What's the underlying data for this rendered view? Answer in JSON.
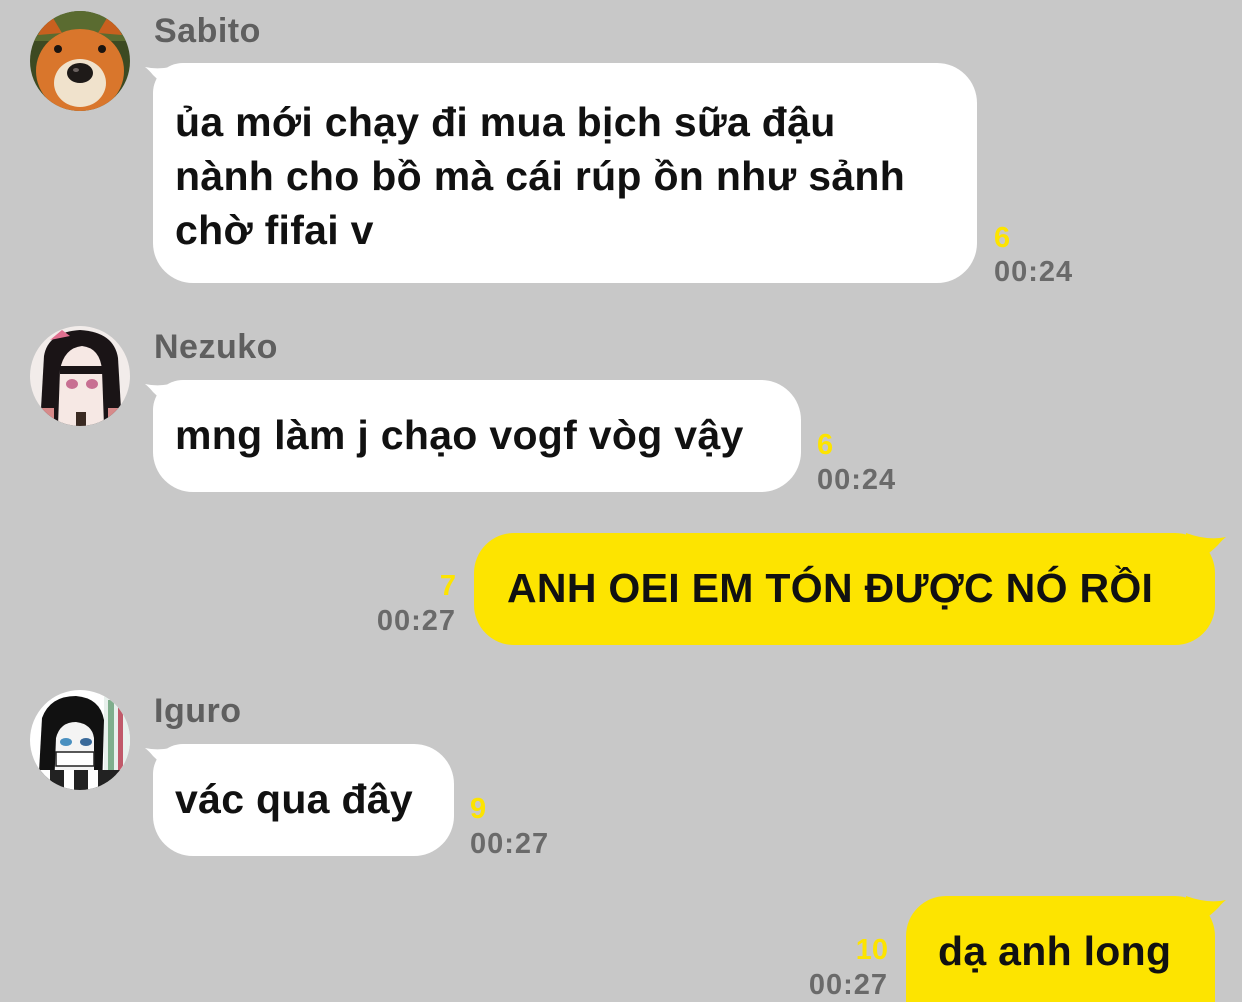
{
  "messages": [
    {
      "sender": "Sabito",
      "text_lines": [
        "ủa mới chạy đi mua bịch sữa đậu",
        "nành cho bồ mà cái rúp ồn như sảnh",
        "chờ fifai v"
      ],
      "unread": "6",
      "time": "00:24",
      "direction": "incoming",
      "avatar": "fox-avatar-icon"
    },
    {
      "sender": "Nezuko",
      "text": "mng làm j chạo vogf vòg vậy",
      "unread": "6",
      "time": "00:24",
      "direction": "incoming",
      "avatar": "nezuko-avatar-icon"
    },
    {
      "text": "ANH OEI EM TÓN ĐƯỢC NÓ RỒI",
      "unread": "7",
      "time": "00:27",
      "direction": "outgoing"
    },
    {
      "sender": "Iguro",
      "text": "vác qua đây",
      "unread": "9",
      "time": "00:27",
      "direction": "incoming",
      "avatar": "iguro-avatar-icon"
    },
    {
      "text": "dạ anh long",
      "unread": "10",
      "time": "00:27",
      "direction": "outgoing"
    }
  ],
  "colors": {
    "background": "#c8c8c8",
    "incoming_bubble": "#ffffff",
    "outgoing_bubble": "#fde400",
    "unread_count": "#fde400",
    "timestamp": "#6a6a6a",
    "sender_name": "#5f5f5f"
  }
}
